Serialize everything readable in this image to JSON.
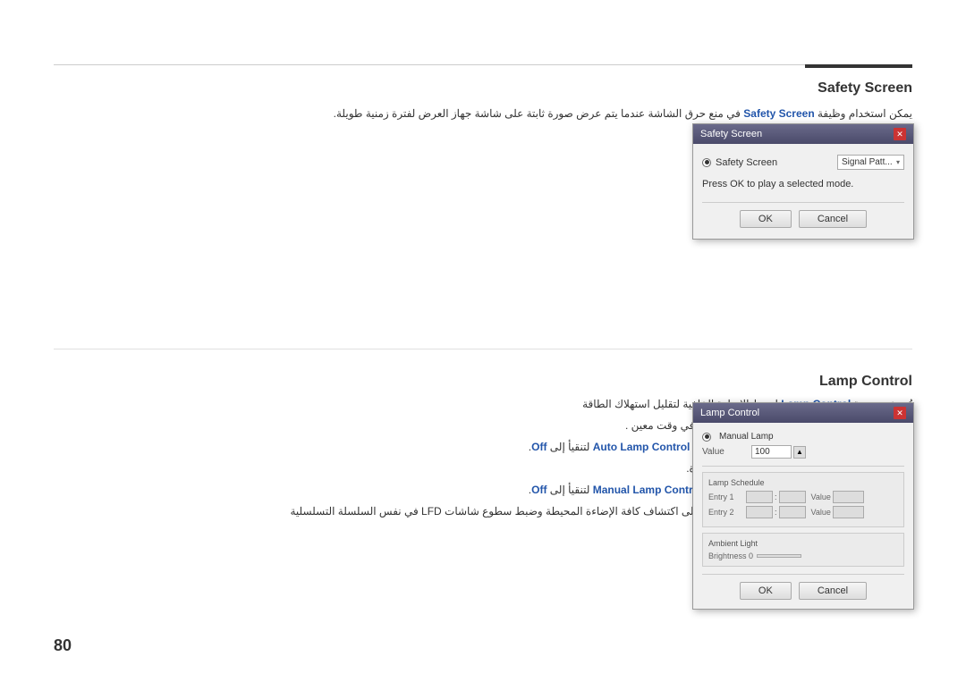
{
  "page": {
    "number": "80",
    "top_line": true
  },
  "safety_screen": {
    "title": "Safety Screen",
    "arabic_text_line1": "يمكن استخدام وظيفة",
    "highlight1": "Safety Screen",
    "arabic_text_line2": "في منع حرق الشاشة عندما يتم عرض صورة ثابتة على شاشة جهاز العرض لفترة زمنية طويلة.",
    "dialog": {
      "title": "Safety Screen",
      "radio_label": "Safety Screen",
      "dropdown_label": "Signal Patt...",
      "message": "Press OK to play a selected mode.",
      "ok_button": "OK",
      "cancel_button": "Cancel"
    }
  },
  "lamp_control": {
    "title": "Lamp Control",
    "arabic_lines": [
      "تُستخدم ميزة Lamp Control لضبط الإضاءة الخلفية لتقليل استهلاك الطاقة",
      "ضبط تلقائي للإضاءة الخلفية بجهاز العرض المحدد في وقت معين.",
      "في حالة ضبط Manual Lamp Control ، سيتحول Auto Lamp Control لتنقيأ إلى Off.",
      "ضبط يدوي للإضاءة الخلفية لشاشة العرض المحددة.",
      "في حالة ضبط Auto Lamp Control ، سيتحول Manual Lamp Control لتنقيأ إلى Off.",
      "• Ambient Light : تعمل ميزة Ambient Light على اكتشاف كافة الإضاءة المحيطة وضبط سطوع شاشات LFD في نفس السلسلة التسلسلية"
    ],
    "dialog": {
      "title": "Lamp Control",
      "radio_label": "Manual Lamp",
      "value_label": "Value",
      "value": "100",
      "lamp_schedule_title": "Lamp Schedule",
      "entry1_label": "Entry 1",
      "entry2_label": "Entry 2",
      "value_col": "Value",
      "ambient_title": "Ambient Light",
      "brightness_label": "Brightness 0",
      "ok_button": "OK",
      "cancel_button": "Cancel"
    }
  }
}
